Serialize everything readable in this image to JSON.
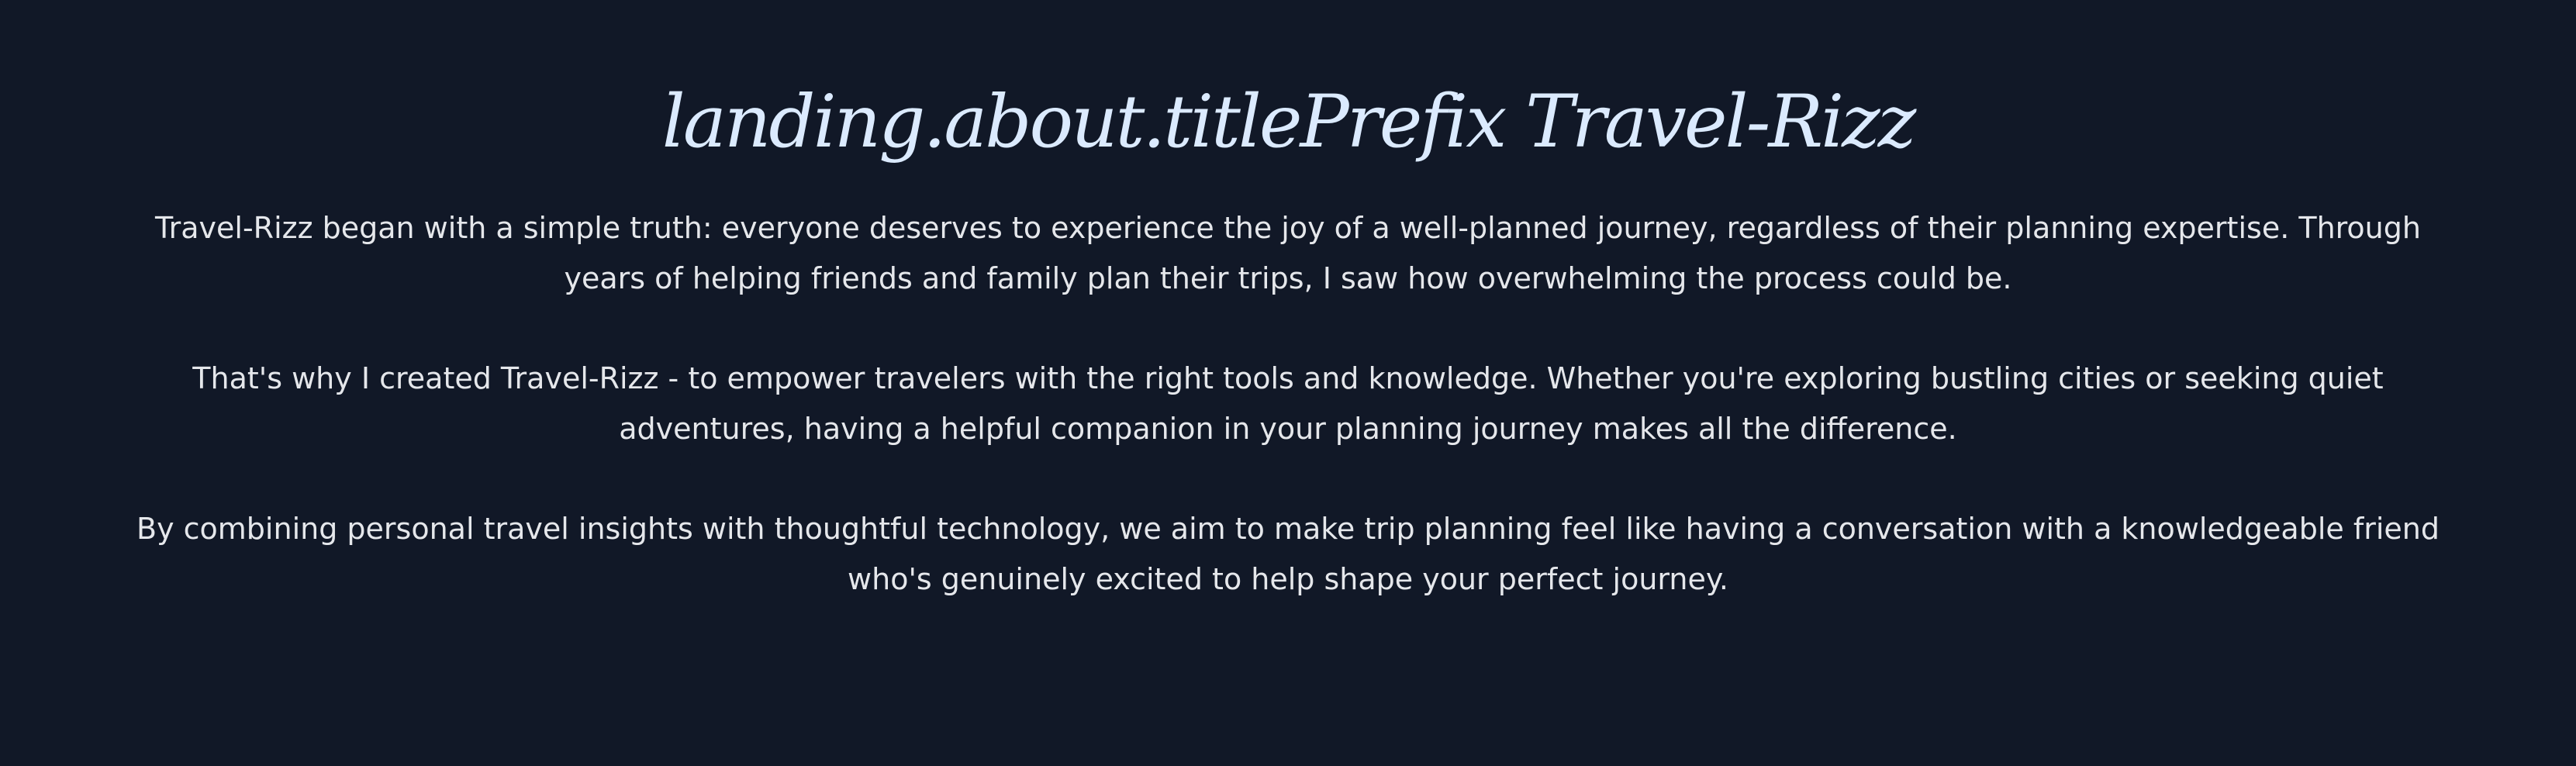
{
  "about": {
    "title": "landing.about.titlePrefix Travel-Rizz",
    "paragraphs": [
      "Travel-Rizz began with a simple truth: everyone deserves to experience the joy of a well-planned journey, regardless of their planning expertise. Through years of helping friends and family plan their trips, I saw how overwhelming the process could be.",
      "That's why I created Travel-Rizz - to empower travelers with the right tools and knowledge. Whether you're exploring bustling cities or seeking quiet adventures, having a helpful companion in your planning journey makes all the difference.",
      "By combining personal travel insights with thoughtful technology, we aim to make trip planning feel like having a conversation with a knowledgeable friend who's genuinely excited to help shape your perfect journey."
    ]
  },
  "colors": {
    "background": "#111827",
    "title": "#dbeafe",
    "body_text": "#e5e7eb"
  }
}
